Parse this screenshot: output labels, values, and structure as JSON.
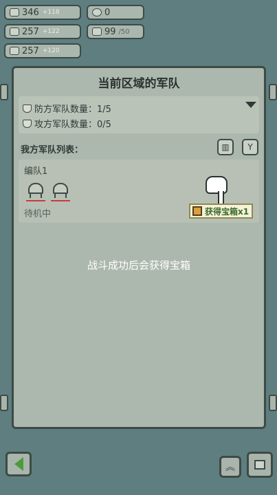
{
  "resources": {
    "wood": {
      "value": "346",
      "delta": "+118",
      "icon": "wood-icon"
    },
    "coin": {
      "value": "0",
      "icon": "coin-icon"
    },
    "stone": {
      "value": "257",
      "delta": "+122",
      "icon": "stone-icon"
    },
    "population": {
      "value": "99",
      "cap": "/50",
      "icon": "population-icon"
    },
    "food": {
      "value": "257",
      "delta": "+120",
      "icon": "food-icon"
    }
  },
  "panel": {
    "title": "当前区域的军队",
    "defense_label": "防方军队数量：1/5",
    "attack_label": "攻方军队数量：0/5",
    "list_label": "我方军队列表：",
    "squad": {
      "name": "编队1",
      "status": "待机中"
    },
    "reward": {
      "label": "获得宝箱x1",
      "icon": "treasure-chest-icon"
    },
    "hint": "战斗成功后会获得宝箱"
  },
  "colors": {
    "background": "#5f7e80",
    "panel": "#acb8ad",
    "border": "#3d4a46",
    "reward_text": "#3d6b2a",
    "unit_underline": "#c63b3b",
    "back_arrow": "#4c9a3e"
  }
}
